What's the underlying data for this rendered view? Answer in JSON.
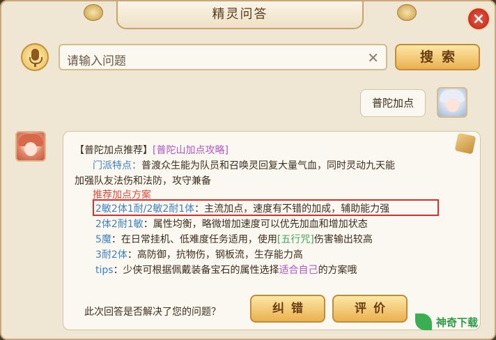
{
  "window": {
    "title": "精灵问答",
    "close_icon": "×"
  },
  "search": {
    "placeholder": "请输入问题",
    "clear_icon": "✕",
    "button_label": "搜索"
  },
  "user_message": "普陀加点",
  "answer": {
    "header_prefix": "【普陀加点推荐】",
    "header_link": "[普陀山加点攻略]",
    "feature_label": "门派特点：",
    "feature_text": "普渡众生能为队员和召唤灵回复大量气血，同时灵动九天能",
    "feature_text2": "加强队友法伤和法防，攻守兼备",
    "plan_title": "推荐加点方案",
    "plans": [
      {
        "name": "2敏2体1耐/2敏2耐1体",
        "desc": "：主流加点，速度有不错的加成，辅助能力强"
      },
      {
        "name": "2体2耐1敏",
        "desc": "：属性均衡，略微增加速度可以优先加血和增加状态"
      },
      {
        "name": "5魔",
        "desc": "：在日常挂机、低难度任务适用，使用",
        "link": "[五行咒]",
        "desc_after": "伤害输出较高"
      },
      {
        "name": "3耐2体",
        "desc": "：高防御，抗物伤，钢板流，生存能力高"
      }
    ],
    "tips_label": "tips",
    "tips_text": "：少侠可根据佩戴装备宝石的属性选择",
    "tips_highlight": "适合自己",
    "tips_end": "的方案哦"
  },
  "footer": {
    "question": "此次回答是否解决了您的问题？",
    "correct_label": "纠错",
    "rate_label": "评价"
  },
  "watermark": {
    "text": "神奇下载"
  },
  "colors": {
    "accent_blue": "#3d82c6",
    "accent_purple": "#b355c6",
    "accent_red": "#e24a3a",
    "highlight_border": "#d9302f"
  }
}
